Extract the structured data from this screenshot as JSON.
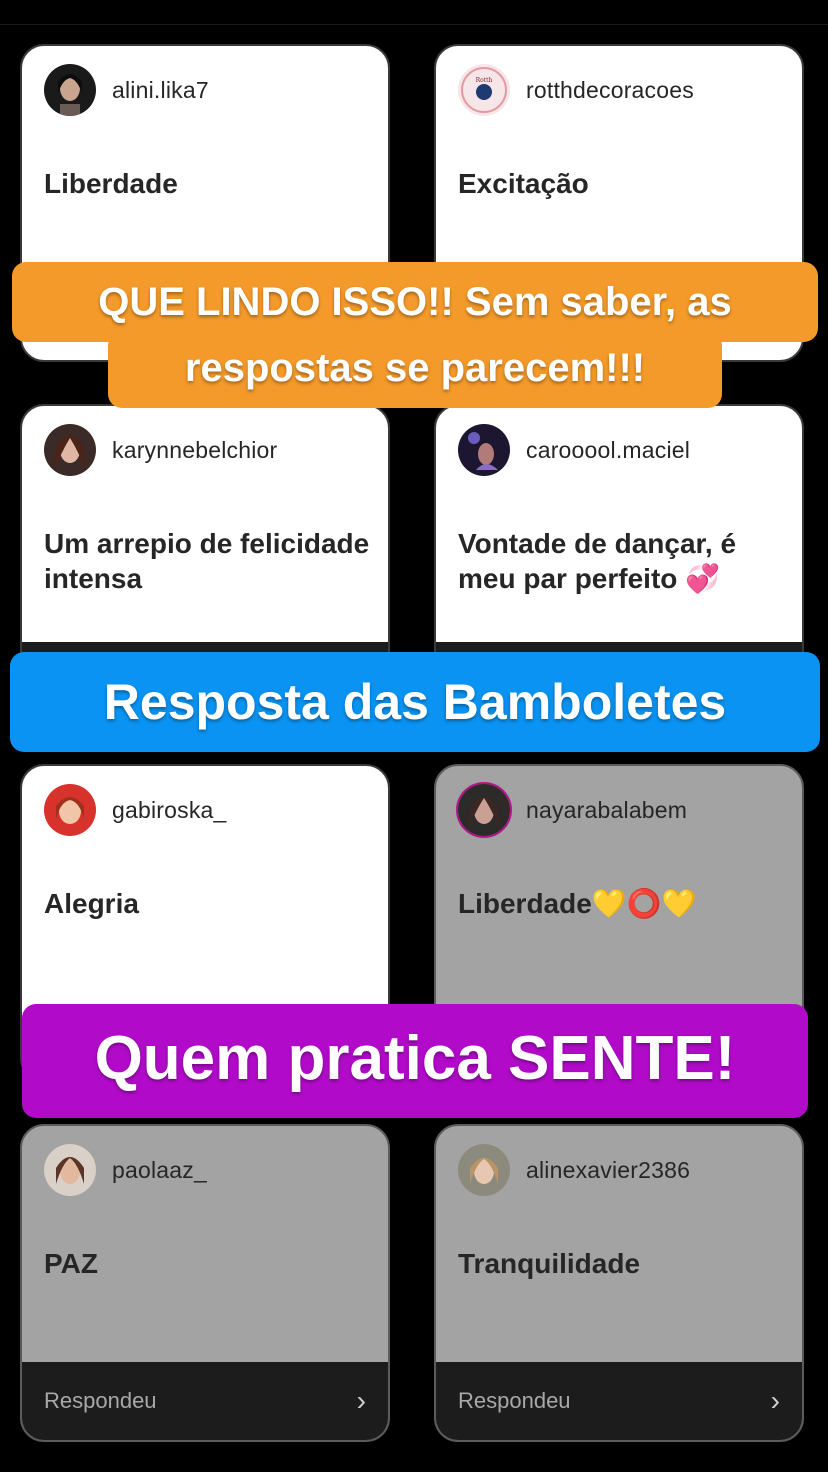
{
  "cards": [
    {
      "username": "alini.lika7",
      "answer": "Liberdade",
      "footer": ""
    },
    {
      "username": "rotthdecoracoes",
      "answer": "Excitação",
      "footer": ""
    },
    {
      "username": "karynnebelchior",
      "answer": "Um arrepio de felicidade intensa",
      "footer": ""
    },
    {
      "username": "carooool.maciel",
      "answer": "Vontade de dançar, é meu par perfeito 💞",
      "footer": ""
    },
    {
      "username": "gabiroska_",
      "answer": "Alegria",
      "footer": ""
    },
    {
      "username": "nayarabalabem",
      "answer": "Liberdade💛⭕💛",
      "footer": ""
    },
    {
      "username": "paolaaz_",
      "answer": "PAZ",
      "footer": "Respondeu"
    },
    {
      "username": "alinexavier2386",
      "answer": "Tranquilidade",
      "footer": "Respondeu"
    }
  ],
  "banners": {
    "orange_line1": "QUE LINDO ISSO!! Sem saber, as",
    "orange_line2": "respostas se parecem!!!",
    "blue": "Resposta das Bamboletes",
    "purple": "Quem pratica SENTE!"
  },
  "colors": {
    "orange": "#f49a2a",
    "blue": "#0a93f2",
    "purple": "#b10bc9"
  },
  "icons": {
    "chevron": "chevron-right-icon"
  }
}
